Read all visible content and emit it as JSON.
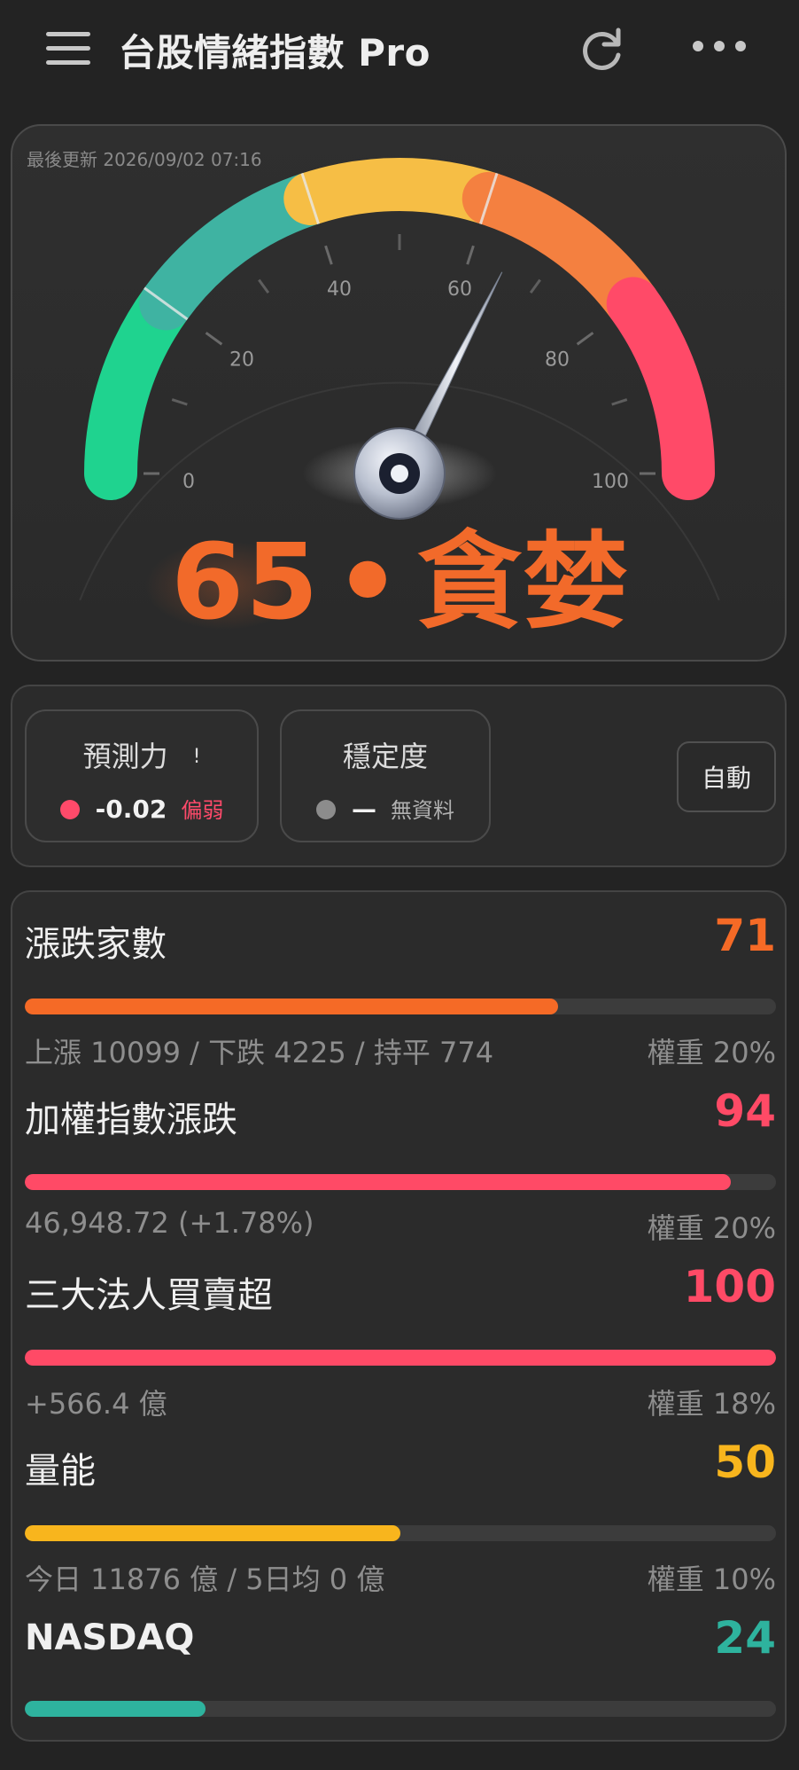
{
  "header": {
    "title": "台股情緒指數 Pro",
    "icons": [
      "menu-icon",
      "refresh-icon",
      "more-icon"
    ]
  },
  "gauge": {
    "last_update": "最後更新 2026/09/02 07:16",
    "value": 65,
    "label": "貪婪",
    "value_display": "65",
    "separator": "•",
    "ticks": [
      "0",
      "20",
      "40",
      "60",
      "80",
      "100"
    ],
    "colors": {
      "extreme_fear": "#1fd38f",
      "fear": "#3fb3a2",
      "neutral": "#f6be45",
      "greed": "#f48040",
      "extreme_greed": "#ff4a68",
      "score": "#f26a2a"
    }
  },
  "indicators": {
    "predictive": {
      "title": "預測力",
      "warn": "!",
      "value": "-0.02",
      "tag": "偏弱",
      "tag_color": "#ff4a6a",
      "dot_color": "#ff4a6a"
    },
    "stability": {
      "title": "穩定度",
      "value": "—",
      "tag": "無資料",
      "tag_color": "#b0b0b0",
      "dot_color": "#8c8c8c"
    },
    "auto_button": "自動"
  },
  "metrics": [
    {
      "name": "漲跌家數",
      "score": "71",
      "level": 0.71,
      "color": "#f56a26",
      "sub": "上漲 10099 / 下跌 4225 / 持平 774",
      "weight": "權重 20%"
    },
    {
      "name": "加權指數漲跌",
      "score": "94",
      "level": 0.94,
      "color": "#ff4a66",
      "sub": "46,948.72 (+1.78%)",
      "weight": "權重 20%"
    },
    {
      "name": "三大法人買賣超",
      "score": "100",
      "level": 1.0,
      "color": "#ff4a66",
      "sub": "+566.4 億",
      "weight": "權重 18%"
    },
    {
      "name": "量能",
      "score": "50",
      "level": 0.5,
      "color": "#f8b51d",
      "sub": "今日 11876 億 / 5日均 0 億",
      "weight": "權重 10%"
    },
    {
      "name": "NASDAQ",
      "score": "24",
      "level": 0.24,
      "color": "#2eb39e",
      "sub": "",
      "weight": ""
    }
  ]
}
